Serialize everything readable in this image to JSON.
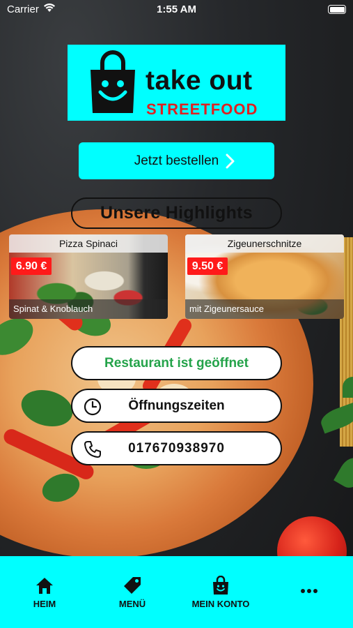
{
  "status_bar": {
    "carrier": "Carrier",
    "time": "1:55 AM"
  },
  "logo": {
    "line1": "take out",
    "line2": "STREETFOOD",
    "background": "#00ffff",
    "accent": "#e02020"
  },
  "order_button": {
    "label": "Jetzt bestellen"
  },
  "highlights": {
    "title": "Unsere Highlights",
    "items": [
      {
        "name": "Pizza Spinaci",
        "price": "6.90 €",
        "description": "Spinat & Knoblauch"
      },
      {
        "name": "Zigeunerschnitze",
        "price": "9.50 €",
        "description": "mit Zigeunersauce"
      }
    ]
  },
  "status_button": {
    "label": "Restaurant ist geöffnet",
    "color": "#24a34a"
  },
  "hours_button": {
    "label": "Öffnungszeiten",
    "icon": "clock-icon"
  },
  "phone_button": {
    "label": "017670938970",
    "icon": "phone-icon"
  },
  "tabbar": {
    "items": [
      {
        "label": "HEIM",
        "icon": "home-icon"
      },
      {
        "label": "MENÜ",
        "icon": "tag-icon"
      },
      {
        "label": "MEIN KONTO",
        "icon": "bag-icon"
      },
      {
        "label": "",
        "icon": "more-icon"
      }
    ]
  }
}
